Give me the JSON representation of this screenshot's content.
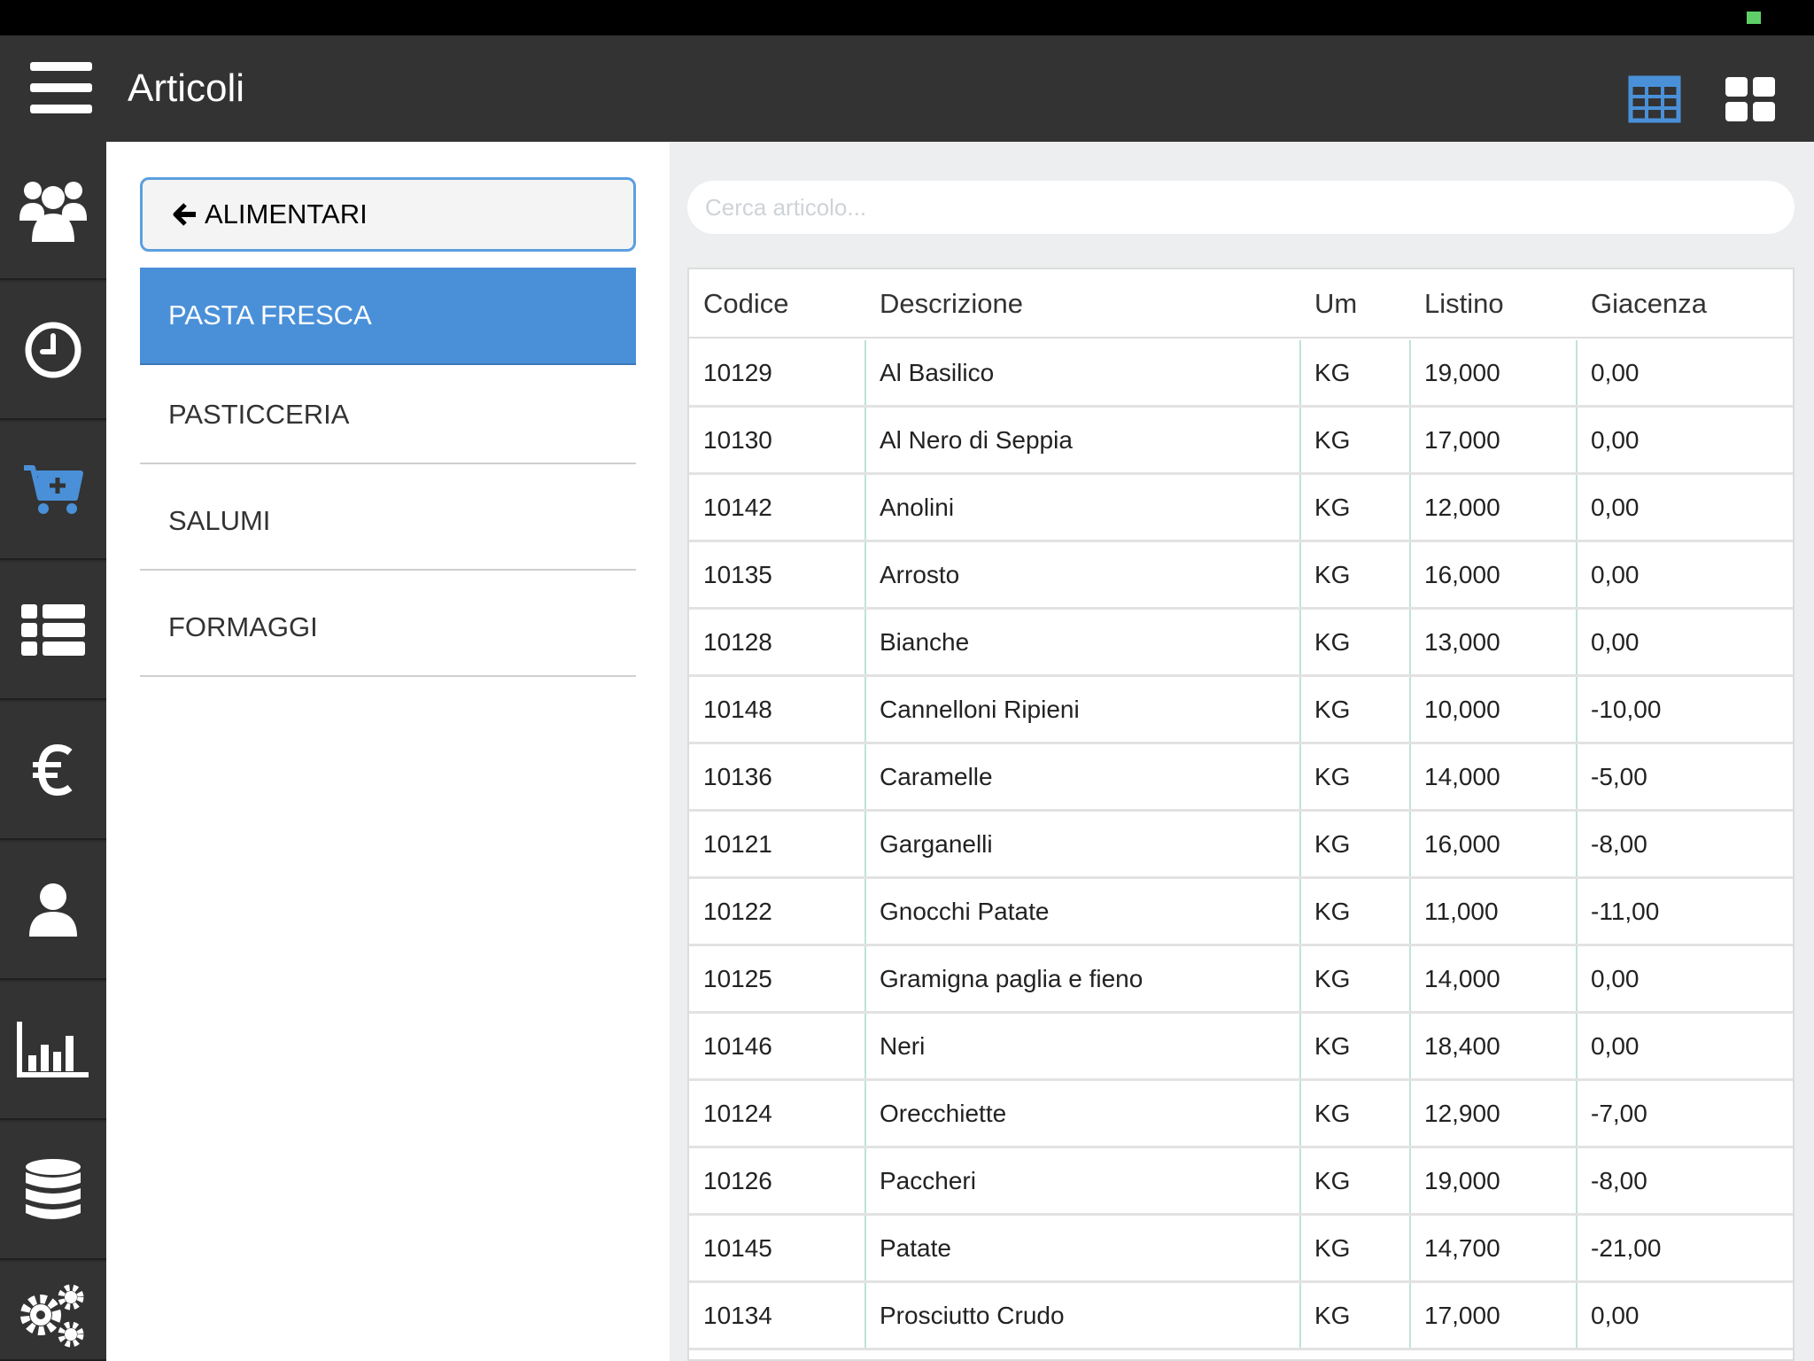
{
  "header": {
    "title": "Articoli"
  },
  "view_toggle": {
    "table_icon": "table-view-icon",
    "grid_icon": "grid-view-icon"
  },
  "sidebar": {
    "icons": [
      "users-icon",
      "clock-icon",
      "cart-add-icon",
      "list-icon",
      "euro-icon",
      "user-icon",
      "bar-chart-icon",
      "database-icon",
      "gears-icon"
    ]
  },
  "categories": {
    "back_label": "ALIMENTARI",
    "items": [
      {
        "label": "PASTA FRESCA",
        "active": true
      },
      {
        "label": "PASTICCERIA",
        "active": false
      },
      {
        "label": "SALUMI",
        "active": false
      },
      {
        "label": "FORMAGGI",
        "active": false
      }
    ]
  },
  "search": {
    "placeholder": "Cerca articolo..."
  },
  "table": {
    "columns": [
      "Codice",
      "Descrizione",
      "Um",
      "Listino",
      "Giacenza"
    ],
    "rows": [
      [
        "10129",
        "Al Basilico",
        "KG",
        "19,000",
        "0,00"
      ],
      [
        "10130",
        "Al Nero di Seppia",
        "KG",
        "17,000",
        "0,00"
      ],
      [
        "10142",
        "Anolini",
        "KG",
        "12,000",
        "0,00"
      ],
      [
        "10135",
        "Arrosto",
        "KG",
        "16,000",
        "0,00"
      ],
      [
        "10128",
        "Bianche",
        "KG",
        "13,000",
        "0,00"
      ],
      [
        "10148",
        "Cannelloni Ripieni",
        "KG",
        "10,000",
        "-10,00"
      ],
      [
        "10136",
        "Caramelle",
        "KG",
        "14,000",
        "-5,00"
      ],
      [
        "10121",
        "Garganelli",
        "KG",
        "16,000",
        "-8,00"
      ],
      [
        "10122",
        "Gnocchi Patate",
        "KG",
        "11,000",
        "-11,00"
      ],
      [
        "10125",
        "Gramigna paglia e fieno",
        "KG",
        "14,000",
        "0,00"
      ],
      [
        "10146",
        "Neri",
        "KG",
        "18,400",
        "0,00"
      ],
      [
        "10124",
        "Orecchiette",
        "KG",
        "12,900",
        "-7,00"
      ],
      [
        "10126",
        "Paccheri",
        "KG",
        "19,000",
        "-8,00"
      ],
      [
        "10145",
        "Patate",
        "KG",
        "14,700",
        "-21,00"
      ],
      [
        "10134",
        "Prosciutto Crudo",
        "KG",
        "17,000",
        "0,00"
      ]
    ]
  },
  "colors": {
    "accent": "#4a90d9",
    "topbar": "#333333",
    "sidebar": "#333333",
    "content_bg": "#edeef0"
  }
}
